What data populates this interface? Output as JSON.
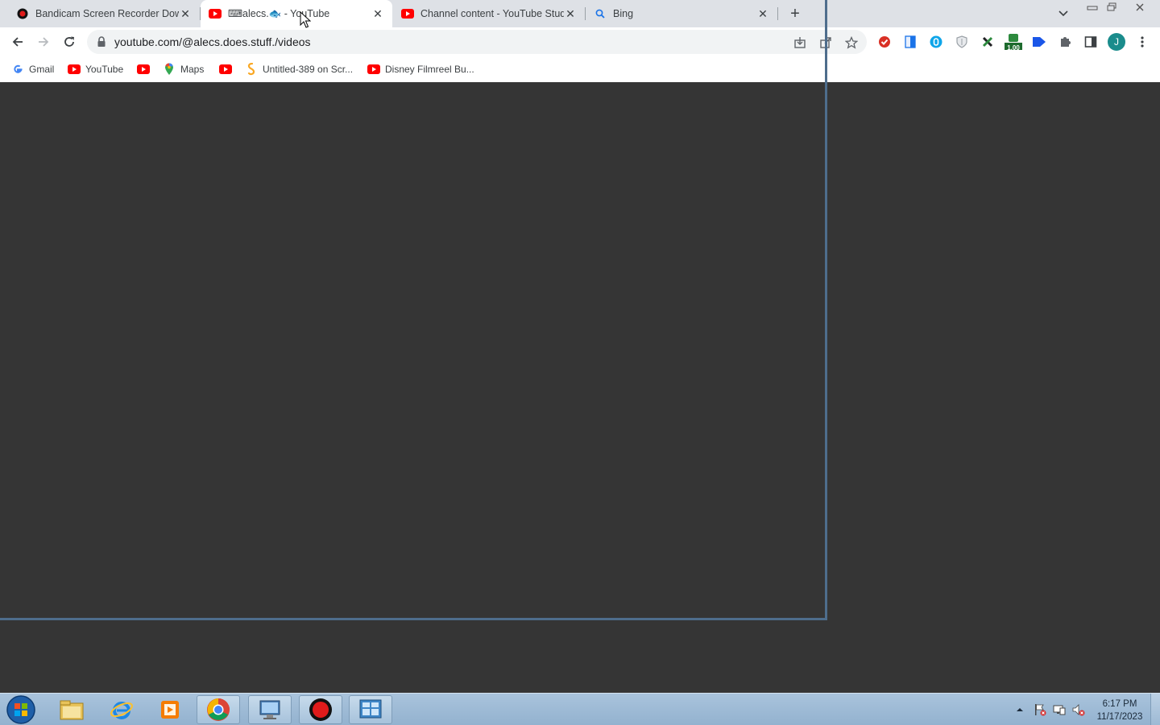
{
  "browser": {
    "tabs": [
      {
        "title": "Bandicam Screen Recorder Down",
        "favicon": "bandicam-icon",
        "active": false
      },
      {
        "title": "⌨alecs.🐟 - YouTube",
        "favicon": "youtube-icon",
        "active": true
      },
      {
        "title": "Channel content - YouTube Studi",
        "favicon": "youtube-icon",
        "active": false
      },
      {
        "title": "Bing",
        "favicon": "search-icon",
        "active": false
      }
    ],
    "new_tab_label": "+",
    "close_glyph": "✕",
    "url": "youtube.com/@alecs.does.stuff./videos",
    "profile_initial": "J",
    "badge_text": "1.00"
  },
  "bookmarks": [
    {
      "label": "Gmail",
      "icon": "google-icon"
    },
    {
      "label": "YouTube",
      "icon": "youtube-icon"
    },
    {
      "label": "",
      "icon": "youtube-icon"
    },
    {
      "label": "Maps",
      "icon": "maps-pin-icon"
    },
    {
      "label": "",
      "icon": "youtube-icon"
    },
    {
      "label": "Untitled-389 on Scr...",
      "icon": "scratch-icon"
    },
    {
      "label": "Disney Filmreel Bu...",
      "icon": "youtube-icon"
    }
  ],
  "taskbar": {
    "apps": [
      "start-orb",
      "file-explorer",
      "internet-explorer",
      "media-player",
      "chrome",
      "remote-desktop",
      "bandicam",
      "control-panel"
    ],
    "clock": {
      "time": "6:17 PM",
      "date": "11/17/2023"
    }
  },
  "colors": {
    "tabstrip": "#dee1e6",
    "page_background": "#353535",
    "selection_frame": "#4e6d8c",
    "youtube_red": "#ff0000",
    "profile": "#1a8c8c"
  }
}
